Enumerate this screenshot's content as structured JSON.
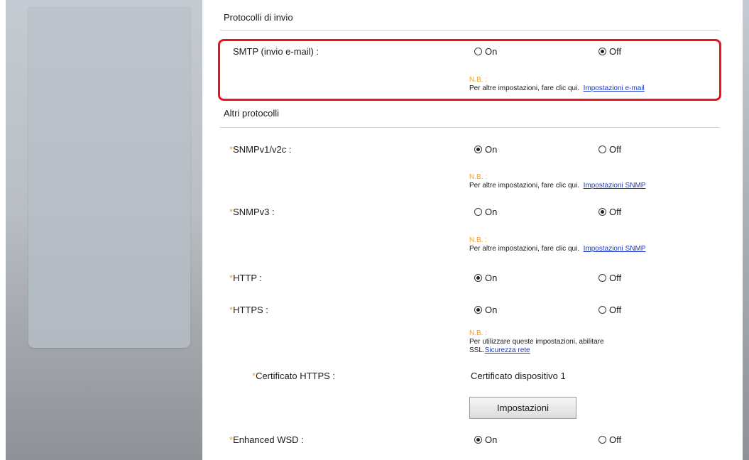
{
  "sections": {
    "send_protocols": "Protocolli di invio",
    "other_protocols": "Altri protocolli"
  },
  "options": {
    "on": "On",
    "off": "Off"
  },
  "note_prefix": "N.B. :",
  "required_mark": "*",
  "rows": {
    "smtp": {
      "label": "SMTP (invio e-mail) :",
      "required": false,
      "selected": "off",
      "note_text": "Per altre impostazioni, fare clic qui.",
      "note_link": "Impostazioni e-mail"
    },
    "snmpv1v2c": {
      "label": "SNMPv1/v2c :",
      "required": true,
      "selected": "on",
      "note_text": "Per altre impostazioni, fare clic qui.",
      "note_link": "Impostazioni SNMP"
    },
    "snmpv3": {
      "label": "SNMPv3 :",
      "required": true,
      "selected": "off",
      "note_text": "Per altre impostazioni, fare clic qui.",
      "note_link": "Impostazioni SNMP"
    },
    "http": {
      "label": "HTTP :",
      "required": true,
      "selected": "on"
    },
    "https": {
      "label": "HTTPS :",
      "required": true,
      "selected": "on",
      "note_line1": "Per utilizzare queste impostazioni, abilitare",
      "note_line2": "SSL.",
      "note_link": "Sicurezza rete"
    },
    "https_cert": {
      "label": "Certificato HTTPS :",
      "required": true,
      "value": "Certificato dispositivo 1",
      "button": "Impostazioni"
    },
    "enhanced_wsd": {
      "label": "Enhanced WSD :",
      "required": true,
      "selected": "on"
    }
  },
  "colors": {
    "highlight": "#e8141c",
    "required": "#f0a030",
    "link": "#1a38c8",
    "note_label": "#f0a030"
  }
}
